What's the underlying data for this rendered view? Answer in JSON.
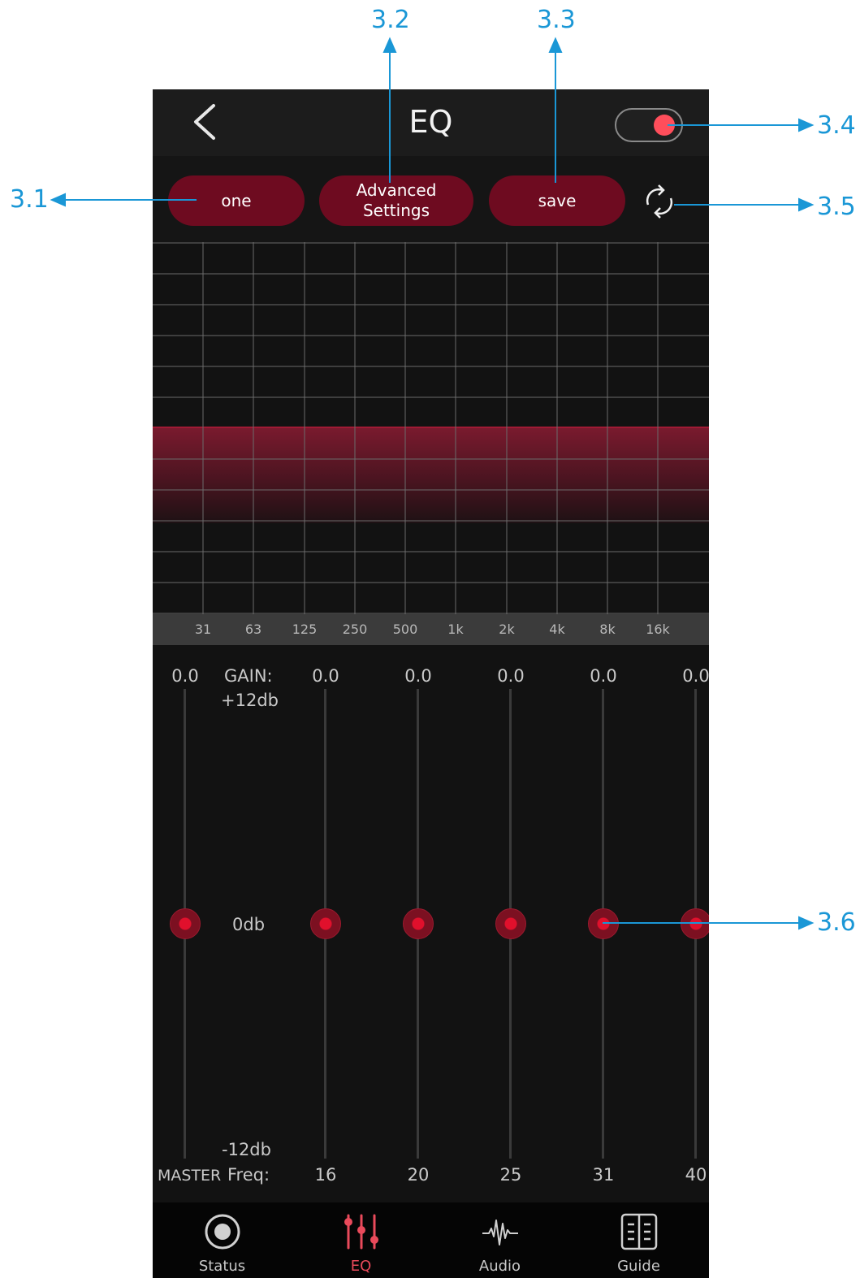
{
  "callouts": {
    "c31": "3.1",
    "c32": "3.2",
    "c33": "3.3",
    "c34": "3.4",
    "c35": "3.5",
    "c36": "3.6"
  },
  "appbar": {
    "title": "EQ",
    "toggle_on": true
  },
  "buttons": {
    "preset": "one",
    "advanced": "Advanced\nSettings",
    "save": "save"
  },
  "graph_freqs": [
    "31",
    "63",
    "125",
    "250",
    "500",
    "1k",
    "2k",
    "4k",
    "8k",
    "16k"
  ],
  "gain_label": {
    "title": "GAIN:",
    "max": "+12db",
    "mid": "0db",
    "min": "-12db"
  },
  "sliders": {
    "master": {
      "value": "0.0",
      "label": "MASTER"
    },
    "freq_caption": "Freq:",
    "bands": [
      {
        "value": "0.0",
        "freq": "16"
      },
      {
        "value": "0.0",
        "freq": "20"
      },
      {
        "value": "0.0",
        "freq": "25"
      },
      {
        "value": "0.0",
        "freq": "31"
      },
      {
        "value": "0.0",
        "freq": "40"
      }
    ]
  },
  "nav": [
    {
      "label": "Status",
      "icon": "record-icon",
      "active": false
    },
    {
      "label": "EQ",
      "icon": "equalizer-sliders-icon",
      "active": true
    },
    {
      "label": "Audio",
      "icon": "waveform-icon",
      "active": false
    },
    {
      "label": "Guide",
      "icon": "book-icon",
      "active": false
    }
  ],
  "colors": {
    "accent": "#6e0b20",
    "thumb": "#e0102c",
    "active_nav": "#e94a5b",
    "callout": "#1a97d6"
  }
}
